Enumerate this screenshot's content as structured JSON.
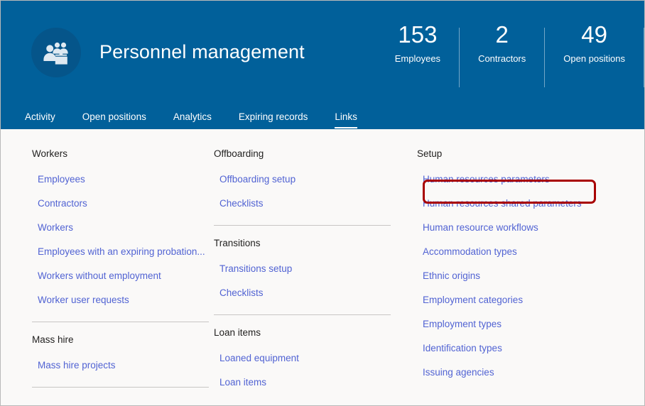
{
  "header": {
    "title": "Personnel management",
    "icon": "people-briefcase-icon",
    "background_color": "#01609A",
    "stats": [
      {
        "value": "153",
        "label": "Employees"
      },
      {
        "value": "2",
        "label": "Contractors"
      },
      {
        "value": "49",
        "label": "Open positions"
      }
    ],
    "tabs": [
      {
        "label": "Activity",
        "active": false
      },
      {
        "label": "Open positions",
        "active": false
      },
      {
        "label": "Analytics",
        "active": false
      },
      {
        "label": "Expiring records",
        "active": false
      },
      {
        "label": "Links",
        "active": true
      }
    ]
  },
  "link_color": "#5163D3",
  "highlight": {
    "target": "Human resources parameters",
    "color": "#A80000"
  },
  "columns": [
    {
      "name": "column-1",
      "groups": [
        {
          "title": "Workers",
          "links": [
            "Employees",
            "Contractors",
            "Workers",
            "Employees with an expiring probation...",
            "Workers without employment",
            "Worker user requests"
          ],
          "divider_after": true
        },
        {
          "title": "Mass hire",
          "links": [
            "Mass hire projects"
          ],
          "divider_after": true
        }
      ]
    },
    {
      "name": "column-2",
      "groups": [
        {
          "title": "Offboarding",
          "links": [
            "Offboarding setup",
            "Checklists"
          ],
          "divider_after": true
        },
        {
          "title": "Transitions",
          "links": [
            "Transitions setup",
            "Checklists"
          ],
          "divider_after": true
        },
        {
          "title": "Loan items",
          "links": [
            "Loaned equipment",
            "Loan items"
          ],
          "divider_after": false
        }
      ]
    },
    {
      "name": "column-3",
      "groups": [
        {
          "title": "Setup",
          "links": [
            "Human resources parameters",
            "Human resources shared parameters",
            "Human resource workflows",
            "Accommodation types",
            "Ethnic origins",
            "Employment categories",
            "Employment types",
            "Identification types",
            "Issuing agencies"
          ],
          "divider_after": false
        }
      ]
    }
  ]
}
